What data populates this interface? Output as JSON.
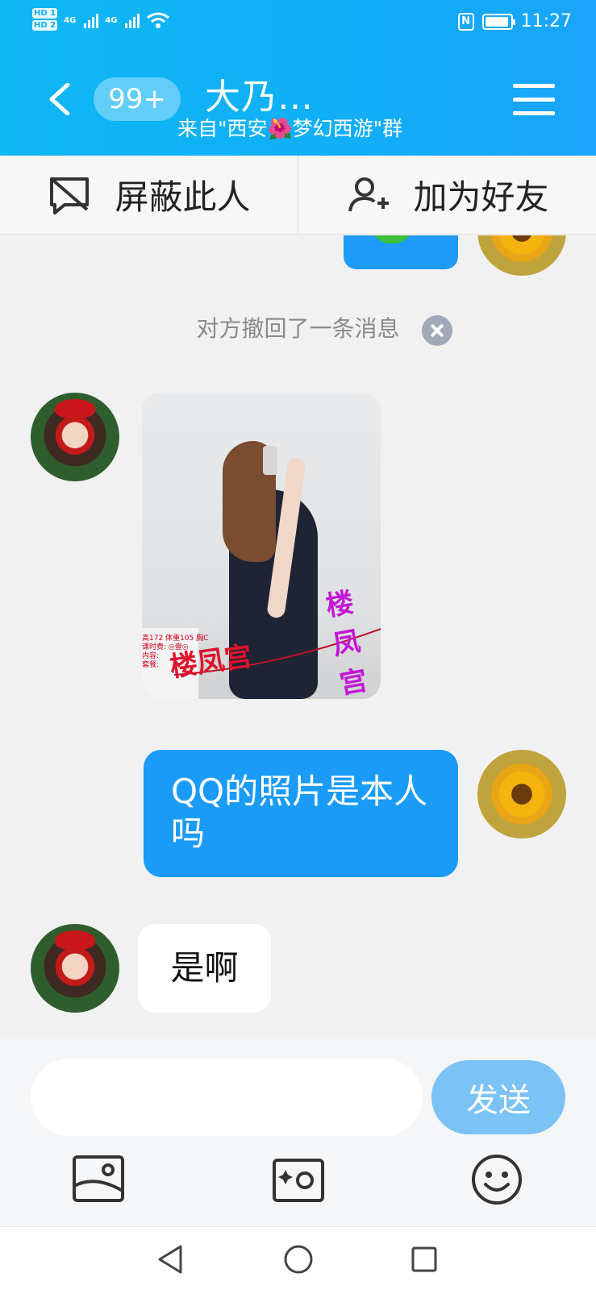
{
  "status_bar": {
    "time": "11:27",
    "sim1": "HD 1",
    "sim2": "HD 2",
    "network": "4G",
    "nfc": "N"
  },
  "header": {
    "unread_count": "99+",
    "title": "大乃…",
    "subtitle": "来自\"西安🌺梦幻西游\"群"
  },
  "actions": {
    "block_label": "屏蔽此人",
    "add_friend_label": "加为好友"
  },
  "chat": {
    "recall_notice": "对方撤回了一条消息",
    "photo_watermark_red": "楼凤宫",
    "photo_watermark_purple": "楼凤宫",
    "photo_small_text": "高172 体重105 胸C\n课时费: ◎壹◎\n内容:\n套餐:",
    "messages": [
      {
        "sender": "me",
        "text": "QQ的照片是本人吗"
      },
      {
        "sender": "them",
        "text": "是啊"
      }
    ]
  },
  "input": {
    "placeholder": "",
    "value": "",
    "send_label": "发送"
  },
  "toolbar": {
    "icons": [
      "photo-album-icon",
      "camera-icon",
      "emoji-icon"
    ]
  },
  "colors": {
    "header_start": "#0fb7f3",
    "header_end": "#1aa4fb",
    "my_bubble": "#1a9bf7",
    "send_button": "#7cc3f5"
  }
}
